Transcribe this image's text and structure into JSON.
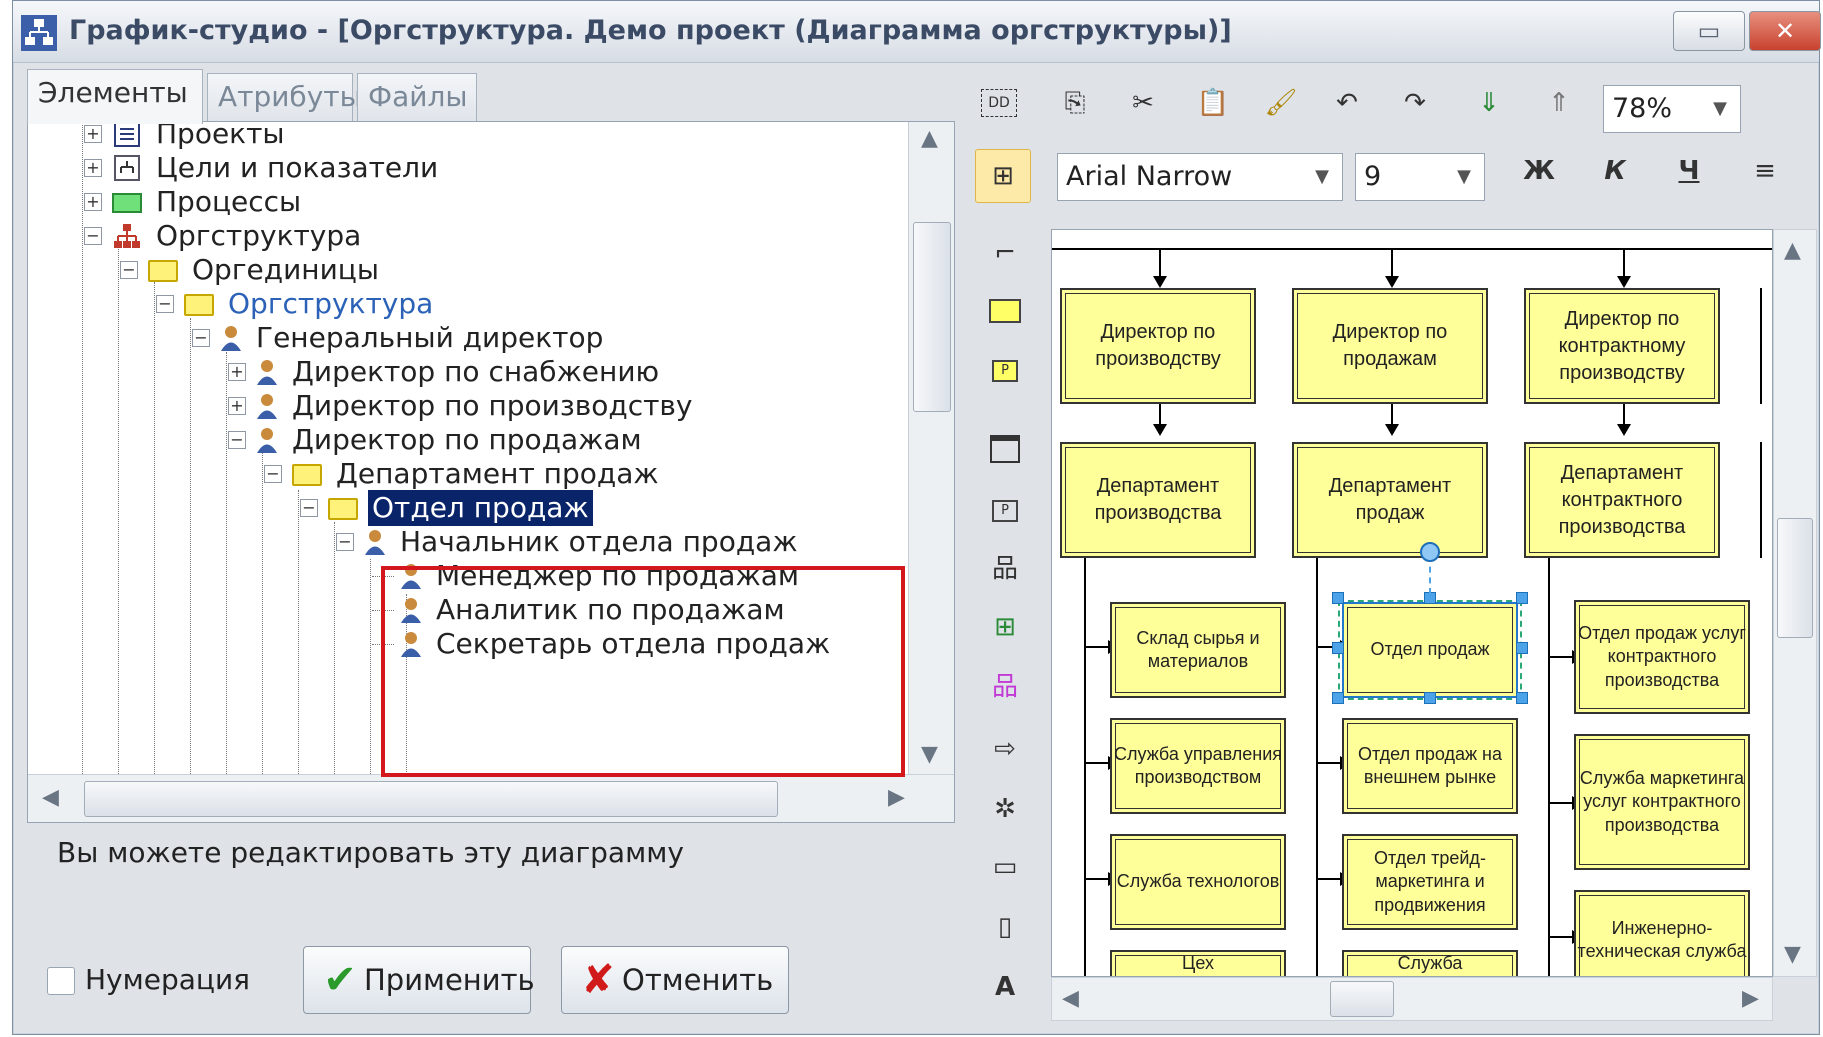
{
  "window": {
    "title": "График-студио - [Оргструктура. Демо проект (Диаграмма оргструктуры)]"
  },
  "tabs": [
    "Элементы",
    "Атрибуты",
    "Файлы"
  ],
  "tree": {
    "items": [
      {
        "label": "Проекты"
      },
      {
        "label": "Цели и показатели"
      },
      {
        "label": "Процессы"
      },
      {
        "label": "Оргструктура"
      },
      {
        "label": "Оргединицы"
      },
      {
        "label": "Оргструктура"
      },
      {
        "label": "Генеральный директор"
      },
      {
        "label": "Директор по снабжению"
      },
      {
        "label": "Директор по производству"
      },
      {
        "label": "Директор по продажам"
      },
      {
        "label": "Департамент продаж"
      },
      {
        "label": "Отдел продаж"
      },
      {
        "label": "Начальник отдела продаж"
      },
      {
        "label": "Менеджер по продажам"
      },
      {
        "label": "Аналитик по продажам"
      },
      {
        "label": "Секретарь отдела продаж"
      }
    ]
  },
  "hint": "Вы можете редактировать эту диаграмму",
  "numbering_label": "Нумерация",
  "apply_label": "Применить",
  "cancel_label": "Отменить",
  "toolbar": {
    "zoom": "78%",
    "font": "Arial Narrow",
    "font_size": "9",
    "bold": "Ж",
    "italic": "К",
    "underline": "Ч"
  },
  "diagram": {
    "directors": [
      "Директор по производству",
      "Директор по продажам",
      "Директор по контрактному производству"
    ],
    "departments": [
      "Департамент производства",
      "Департамент продаж",
      "Департамент контрактного производства"
    ],
    "col1": [
      "Склад сырья и материалов",
      "Служба управления производством",
      "Служба технологов",
      "Цех"
    ],
    "col2": [
      "Отдел продаж",
      "Отдел продаж на внешнем рынке",
      "Отдел трейд-маркетинга и продвижения",
      "Служба"
    ],
    "col3": [
      "Отдел продаж услуг контрактного производства",
      "Служба маркетинга услуг контрактного производства",
      "Инженерно-техническая служба"
    ]
  },
  "colors": {
    "node_fill": "#ffff99",
    "selection_border": "#d4161d",
    "tree_selected": "#0a246a"
  }
}
